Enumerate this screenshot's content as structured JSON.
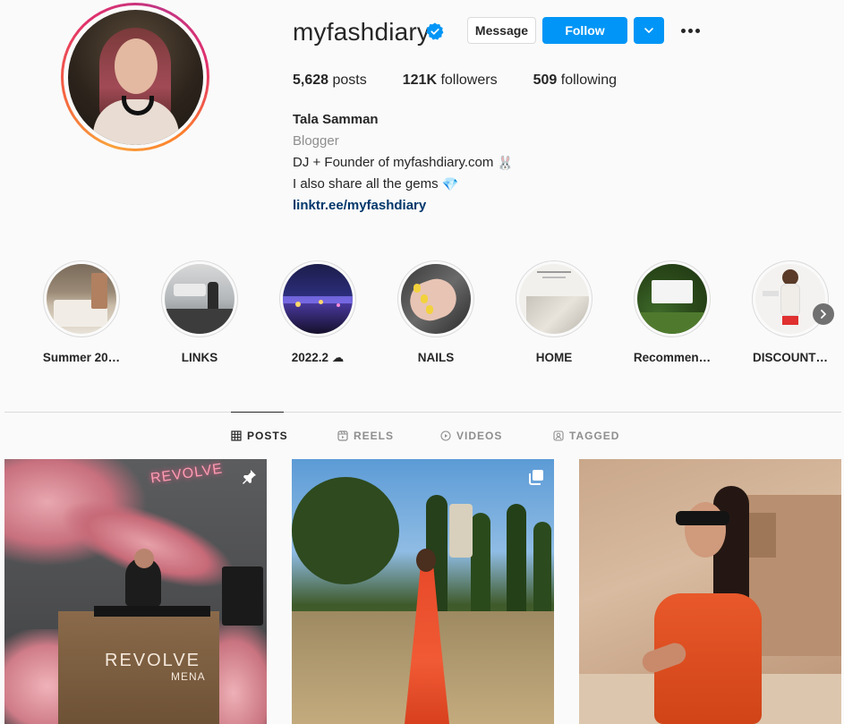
{
  "profile": {
    "username": "myfashdiary",
    "verified_icon": "verified-badge-icon",
    "buttons": {
      "message": "Message",
      "follow": "Follow"
    },
    "stats": {
      "posts_count": "5,628",
      "posts_label": "posts",
      "followers_count": "121K",
      "followers_label": "followers",
      "following_count": "509",
      "following_label": "following"
    },
    "full_name": "Tala Samman",
    "category": "Blogger",
    "bio_line1": "DJ + Founder of myfashdiary.com",
    "bio_line1_emoji": "🐰",
    "bio_line2": "I also share all the gems",
    "bio_line2_emoji": "💎",
    "link": "linktr.ee/myfashdiary"
  },
  "highlights": [
    {
      "label": "Summer 20…"
    },
    {
      "label": "LINKS"
    },
    {
      "label": "2022.2 ☁"
    },
    {
      "label": "NAILS"
    },
    {
      "label": "HOME"
    },
    {
      "label": "Recommen…"
    },
    {
      "label": "DISCOUNT…"
    }
  ],
  "tabs": [
    {
      "label": "POSTS",
      "icon": "grid-icon",
      "active": true
    },
    {
      "label": "REELS",
      "icon": "reels-icon",
      "active": false
    },
    {
      "label": "VIDEOS",
      "icon": "play-icon",
      "active": false
    },
    {
      "label": "TAGGED",
      "icon": "tagged-icon",
      "active": false
    }
  ],
  "posts": [
    {
      "overlay_icon": "pin-icon",
      "caption_text": "REVOLVE",
      "caption_sub": "MENA"
    },
    {
      "overlay_icon": "carousel-icon"
    },
    {
      "overlay_icon": ""
    }
  ],
  "colors": {
    "accent": "#0095f6",
    "link": "#00376b",
    "text": "#262626",
    "muted": "#8e8e8e",
    "border": "#dbdbdb",
    "background": "#fafafa"
  }
}
